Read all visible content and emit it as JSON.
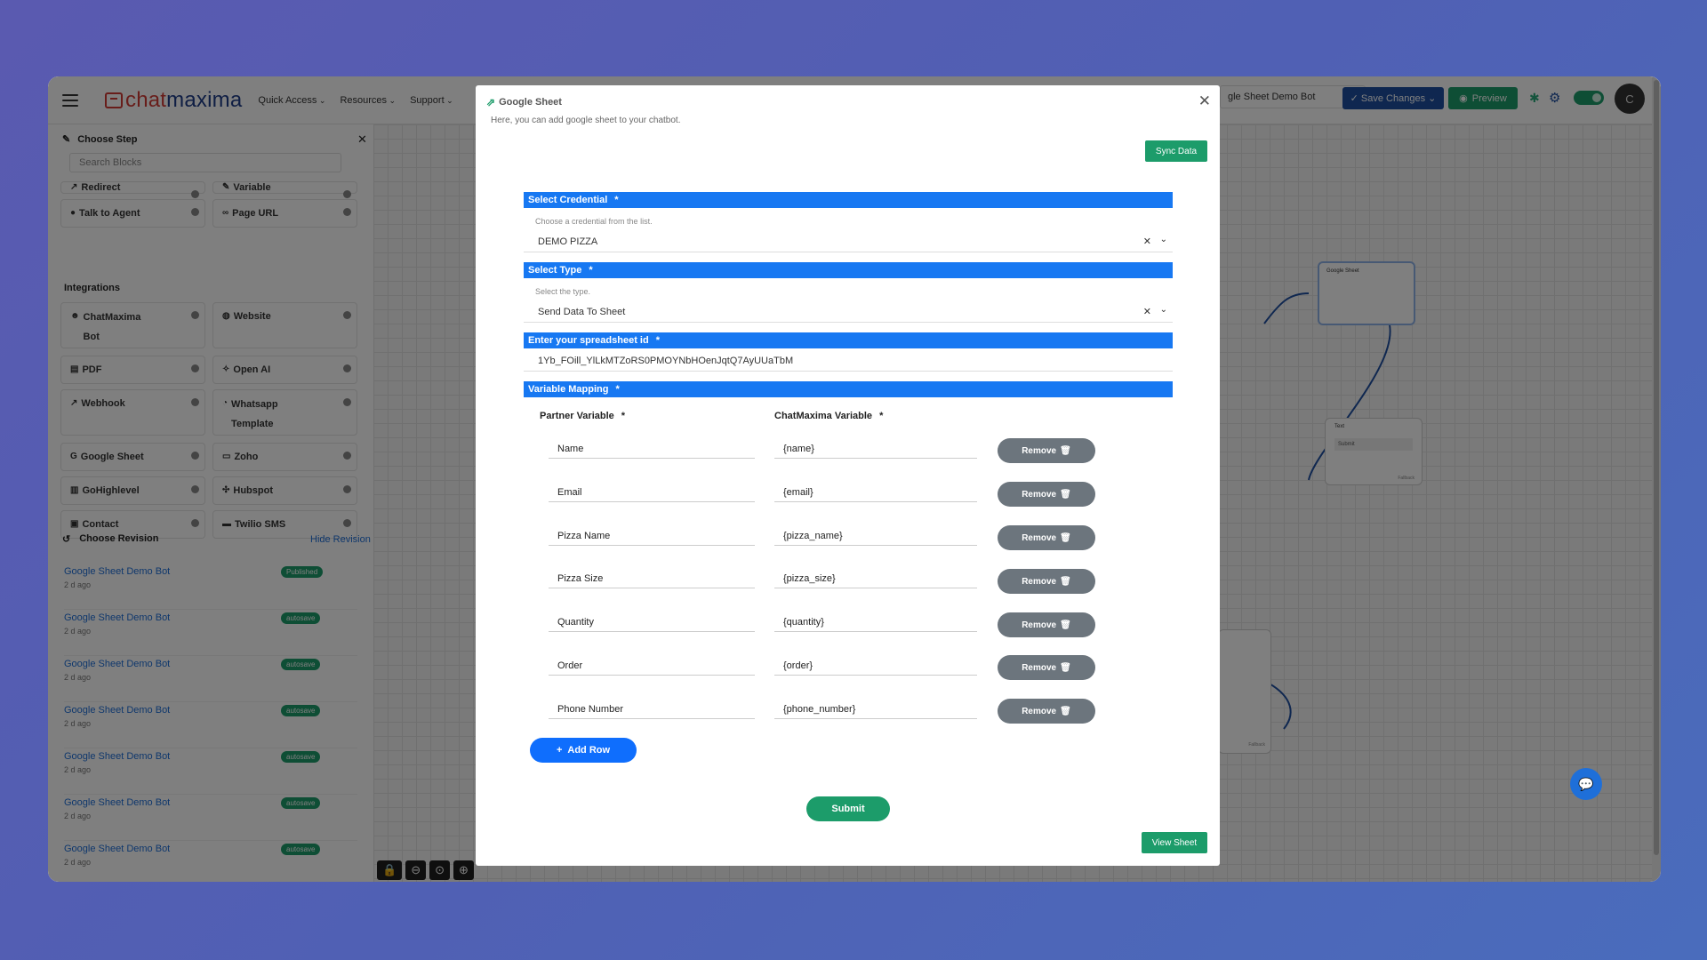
{
  "topbar": {
    "nav": [
      "Quick Access",
      "Resources",
      "Support"
    ],
    "logo_left": "chat",
    "logo_right": "maxima",
    "bot_name": "gle Sheet Demo Bot",
    "save_label": "Save Changes",
    "preview_label": "Preview",
    "avatar_letter": "C"
  },
  "sidebar": {
    "title": "Choose Step",
    "search_placeholder": "Search Blocks",
    "blocks_top": [
      {
        "label": "Redirect"
      },
      {
        "label": "Variable"
      },
      {
        "label": "Talk to Agent"
      },
      {
        "label": "Page URL"
      }
    ],
    "integrations_label": "Integrations",
    "integrations": [
      {
        "label": "ChatMaxima Bot"
      },
      {
        "label": "Website"
      },
      {
        "label": "PDF"
      },
      {
        "label": "Open AI"
      },
      {
        "label": "Webhook"
      },
      {
        "label": "Whatsapp Template"
      },
      {
        "label": "Google Sheet"
      },
      {
        "label": "Zoho"
      },
      {
        "label": "GoHighlevel"
      },
      {
        "label": "Hubspot"
      },
      {
        "label": "Contact"
      },
      {
        "label": "Twilio SMS"
      }
    ],
    "revision_title": "Choose Revision",
    "revision_hide": "Hide Revision",
    "revisions": [
      {
        "name": "Google Sheet Demo Bot",
        "age": "2 d ago",
        "badge": "Published"
      },
      {
        "name": "Google Sheet Demo Bot",
        "age": "2 d ago",
        "badge": "autosave"
      },
      {
        "name": "Google Sheet Demo Bot",
        "age": "2 d ago",
        "badge": "autosave"
      },
      {
        "name": "Google Sheet Demo Bot",
        "age": "2 d ago",
        "badge": "autosave"
      },
      {
        "name": "Google Sheet Demo Bot",
        "age": "2 d ago",
        "badge": "autosave"
      },
      {
        "name": "Google Sheet Demo Bot",
        "age": "2 d ago",
        "badge": "autosave"
      },
      {
        "name": "Google Sheet Demo Bot",
        "age": "2 d ago",
        "badge": "autosave"
      }
    ]
  },
  "canvas": {
    "node1_title": "Google Sheet",
    "node2_title": "Text",
    "node2_item": "Submit",
    "fallback": "Fallback"
  },
  "modal": {
    "title": "Google Sheet",
    "subtitle": "Here, you can add google sheet to your chatbot.",
    "sync_label": "Sync Data",
    "credential_label": "Select Credential",
    "credential_hint": "Choose a credential from the list.",
    "credential_value": "DEMO PIZZA",
    "type_label": "Select Type",
    "type_hint": "Select the type.",
    "type_value": "Send Data To Sheet",
    "sheet_label": "Enter your spreadsheet id",
    "sheet_value": "1Yb_FOill_YlLkMTZoRS0PMOYNbHOenJqtQ7AyUUaTbM",
    "mapping_label": "Variable Mapping",
    "partner_header": "Partner Variable",
    "chatmaxima_header": "ChatMaxima Variable",
    "required_mark": "*",
    "rows": [
      {
        "partner": "Name",
        "chatmaxima": "{name}"
      },
      {
        "partner": "Email",
        "chatmaxima": "{email}"
      },
      {
        "partner": "Pizza Name",
        "chatmaxima": "{pizza_name}"
      },
      {
        "partner": "Pizza Size",
        "chatmaxima": "{pizza_size}"
      },
      {
        "partner": "Quantity",
        "chatmaxima": "{quantity}"
      },
      {
        "partner": "Order",
        "chatmaxima": "{order}"
      },
      {
        "partner": "Phone Number",
        "chatmaxima": "{phone_number}"
      }
    ],
    "remove_label": "Remove",
    "add_row_label": "Add Row",
    "submit_label": "Submit",
    "view_sheet_label": "View Sheet"
  },
  "colors": {
    "primary_blue": "#1778f2",
    "green": "#1c9c6a",
    "remove_gray": "#6c757d",
    "brand_red": "#d13a35"
  }
}
